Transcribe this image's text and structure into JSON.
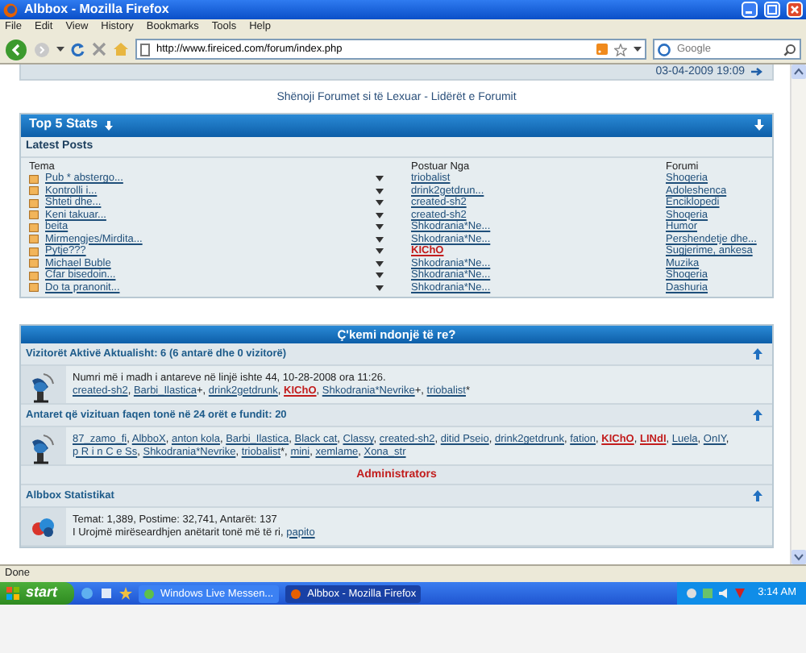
{
  "window": {
    "title": "Albbox - Mozilla Firefox"
  },
  "menu": [
    "File",
    "Edit",
    "View",
    "History",
    "Bookmarks",
    "Tools",
    "Help"
  ],
  "address_bar": {
    "value": "http://www.fireiced.com/forum/index.php"
  },
  "search": {
    "placeholder": "Google"
  },
  "page": {
    "last_post_time": "03-04-2009 19:09",
    "forum_links": "Shënoji Forumet si të Lexuar - Lidërët e Forumit",
    "stats": {
      "title": "Top 5 Stats",
      "subtitle": "Latest Posts",
      "columns": [
        "Tema",
        "Postuar Nga",
        "Forumi"
      ],
      "rows": [
        {
          "topic": "Pub * abstergo...",
          "author": "triobalist",
          "author_admin": false,
          "forum": "Shoqeria"
        },
        {
          "topic": "Kontrolli i...",
          "author": "drink2getdrun...",
          "author_admin": false,
          "forum": "Adoleshenca"
        },
        {
          "topic": "Shteti dhe...",
          "author": "created-sh2",
          "author_admin": false,
          "forum": "Enciklopedi"
        },
        {
          "topic": "Keni takuar...",
          "author": "created-sh2",
          "author_admin": false,
          "forum": "Shoqeria"
        },
        {
          "topic": "beita",
          "author": "Shkodrania*Ne...",
          "author_admin": false,
          "forum": "Humor"
        },
        {
          "topic": "Mirmengjes/Mirdita...",
          "author": "Shkodrania*Ne...",
          "author_admin": false,
          "forum": "Pershendetje dhe..."
        },
        {
          "topic": "Pytje???",
          "author": "KIChO",
          "author_admin": true,
          "forum": "Sugjerime, ankesa"
        },
        {
          "topic": "Michael Buble",
          "author": "Shkodrania*Ne...",
          "author_admin": false,
          "forum": "Muzika"
        },
        {
          "topic": "Cfar bisedoin...",
          "author": "Shkodrania*Ne...",
          "author_admin": false,
          "forum": "Shoqeria"
        },
        {
          "topic": "Do ta pranonit...",
          "author": "Shkodrania*Ne...",
          "author_admin": false,
          "forum": "Dashuria"
        }
      ]
    },
    "whats_new": {
      "title": "Ç'kemi ndonjë të re?",
      "sections": [
        {
          "kind": "users",
          "title": "Vizitorët Aktivë Aktualisht: 6 (6 antarë dhe 0 vizitorë)",
          "note": "Numri më i madh i antareve në linjë ishte 44, 10-28-2008 ora 11:26.",
          "users": [
            {
              "name": "created-sh2",
              "kind": "member",
              "after": ", "
            },
            {
              "name": "Barbi_Ilastica",
              "kind": "member",
              "after": "+, "
            },
            {
              "name": "drink2getdrunk",
              "kind": "member",
              "after": ", "
            },
            {
              "name": "KIChO",
              "kind": "admin",
              "after": ", "
            },
            {
              "name": "Shkodrania*Nevrike",
              "kind": "member",
              "after": "+, "
            },
            {
              "name": "triobalist",
              "kind": "member",
              "after": "*"
            }
          ]
        },
        {
          "kind": "users",
          "title": "Antaret që vizituan faqen tonë në 24 orët e fundit: 20",
          "users": [
            {
              "name": "87_zamo_fi",
              "kind": "member",
              "after": ", "
            },
            {
              "name": "AlbboX",
              "kind": "member",
              "after": ", "
            },
            {
              "name": "anton kola",
              "kind": "member",
              "after": ", "
            },
            {
              "name": "Barbi_Ilastica",
              "kind": "member",
              "after": ", "
            },
            {
              "name": "Black cat",
              "kind": "member",
              "after": ", "
            },
            {
              "name": "Classy",
              "kind": "member",
              "after": ", "
            },
            {
              "name": "created-sh2",
              "kind": "member",
              "after": ", "
            },
            {
              "name": "ditid Pseio",
              "kind": "member",
              "after": ", "
            },
            {
              "name": "drink2getdrunk",
              "kind": "member",
              "after": ", "
            },
            {
              "name": "fation",
              "kind": "member",
              "after": ", "
            },
            {
              "name": "KIChO",
              "kind": "admin",
              "after": ", "
            },
            {
              "name": "LINdI",
              "kind": "admin",
              "after": ", "
            },
            {
              "name": "Luela",
              "kind": "member",
              "after": ", "
            },
            {
              "name": "OnIY",
              "kind": "member",
              "after": ", "
            },
            {
              "name": "p R i n C e Ss",
              "kind": "member",
              "after": ", "
            },
            {
              "name": "Shkodrania*Nevrike",
              "kind": "member",
              "after": ", "
            },
            {
              "name": "triobalist",
              "kind": "member",
              "after": "*, "
            },
            {
              "name": "mini",
              "kind": "member",
              "after": ", "
            },
            {
              "name": "xemlame",
              "kind": "member",
              "after": ", "
            },
            {
              "name": "Xona_str",
              "kind": "member"
            }
          ],
          "legend": "Administrators"
        },
        {
          "kind": "stats",
          "title": "Albbox Statistikat",
          "note": "Temat: 1,389, Postime: 32,741, Antarët: 137",
          "welcome": "I Urojmë mirëseardhjen anëtarit tonë më të ri,",
          "newest": "papito"
        }
      ]
    }
  },
  "status_bar": "Done",
  "taskbar": {
    "start": "start",
    "tasks": [
      {
        "label": "Windows Live Messen...",
        "selected": false
      },
      {
        "label": "Albbox - Mozilla Firefox",
        "selected": true
      }
    ],
    "clock": "3:14 AM"
  }
}
